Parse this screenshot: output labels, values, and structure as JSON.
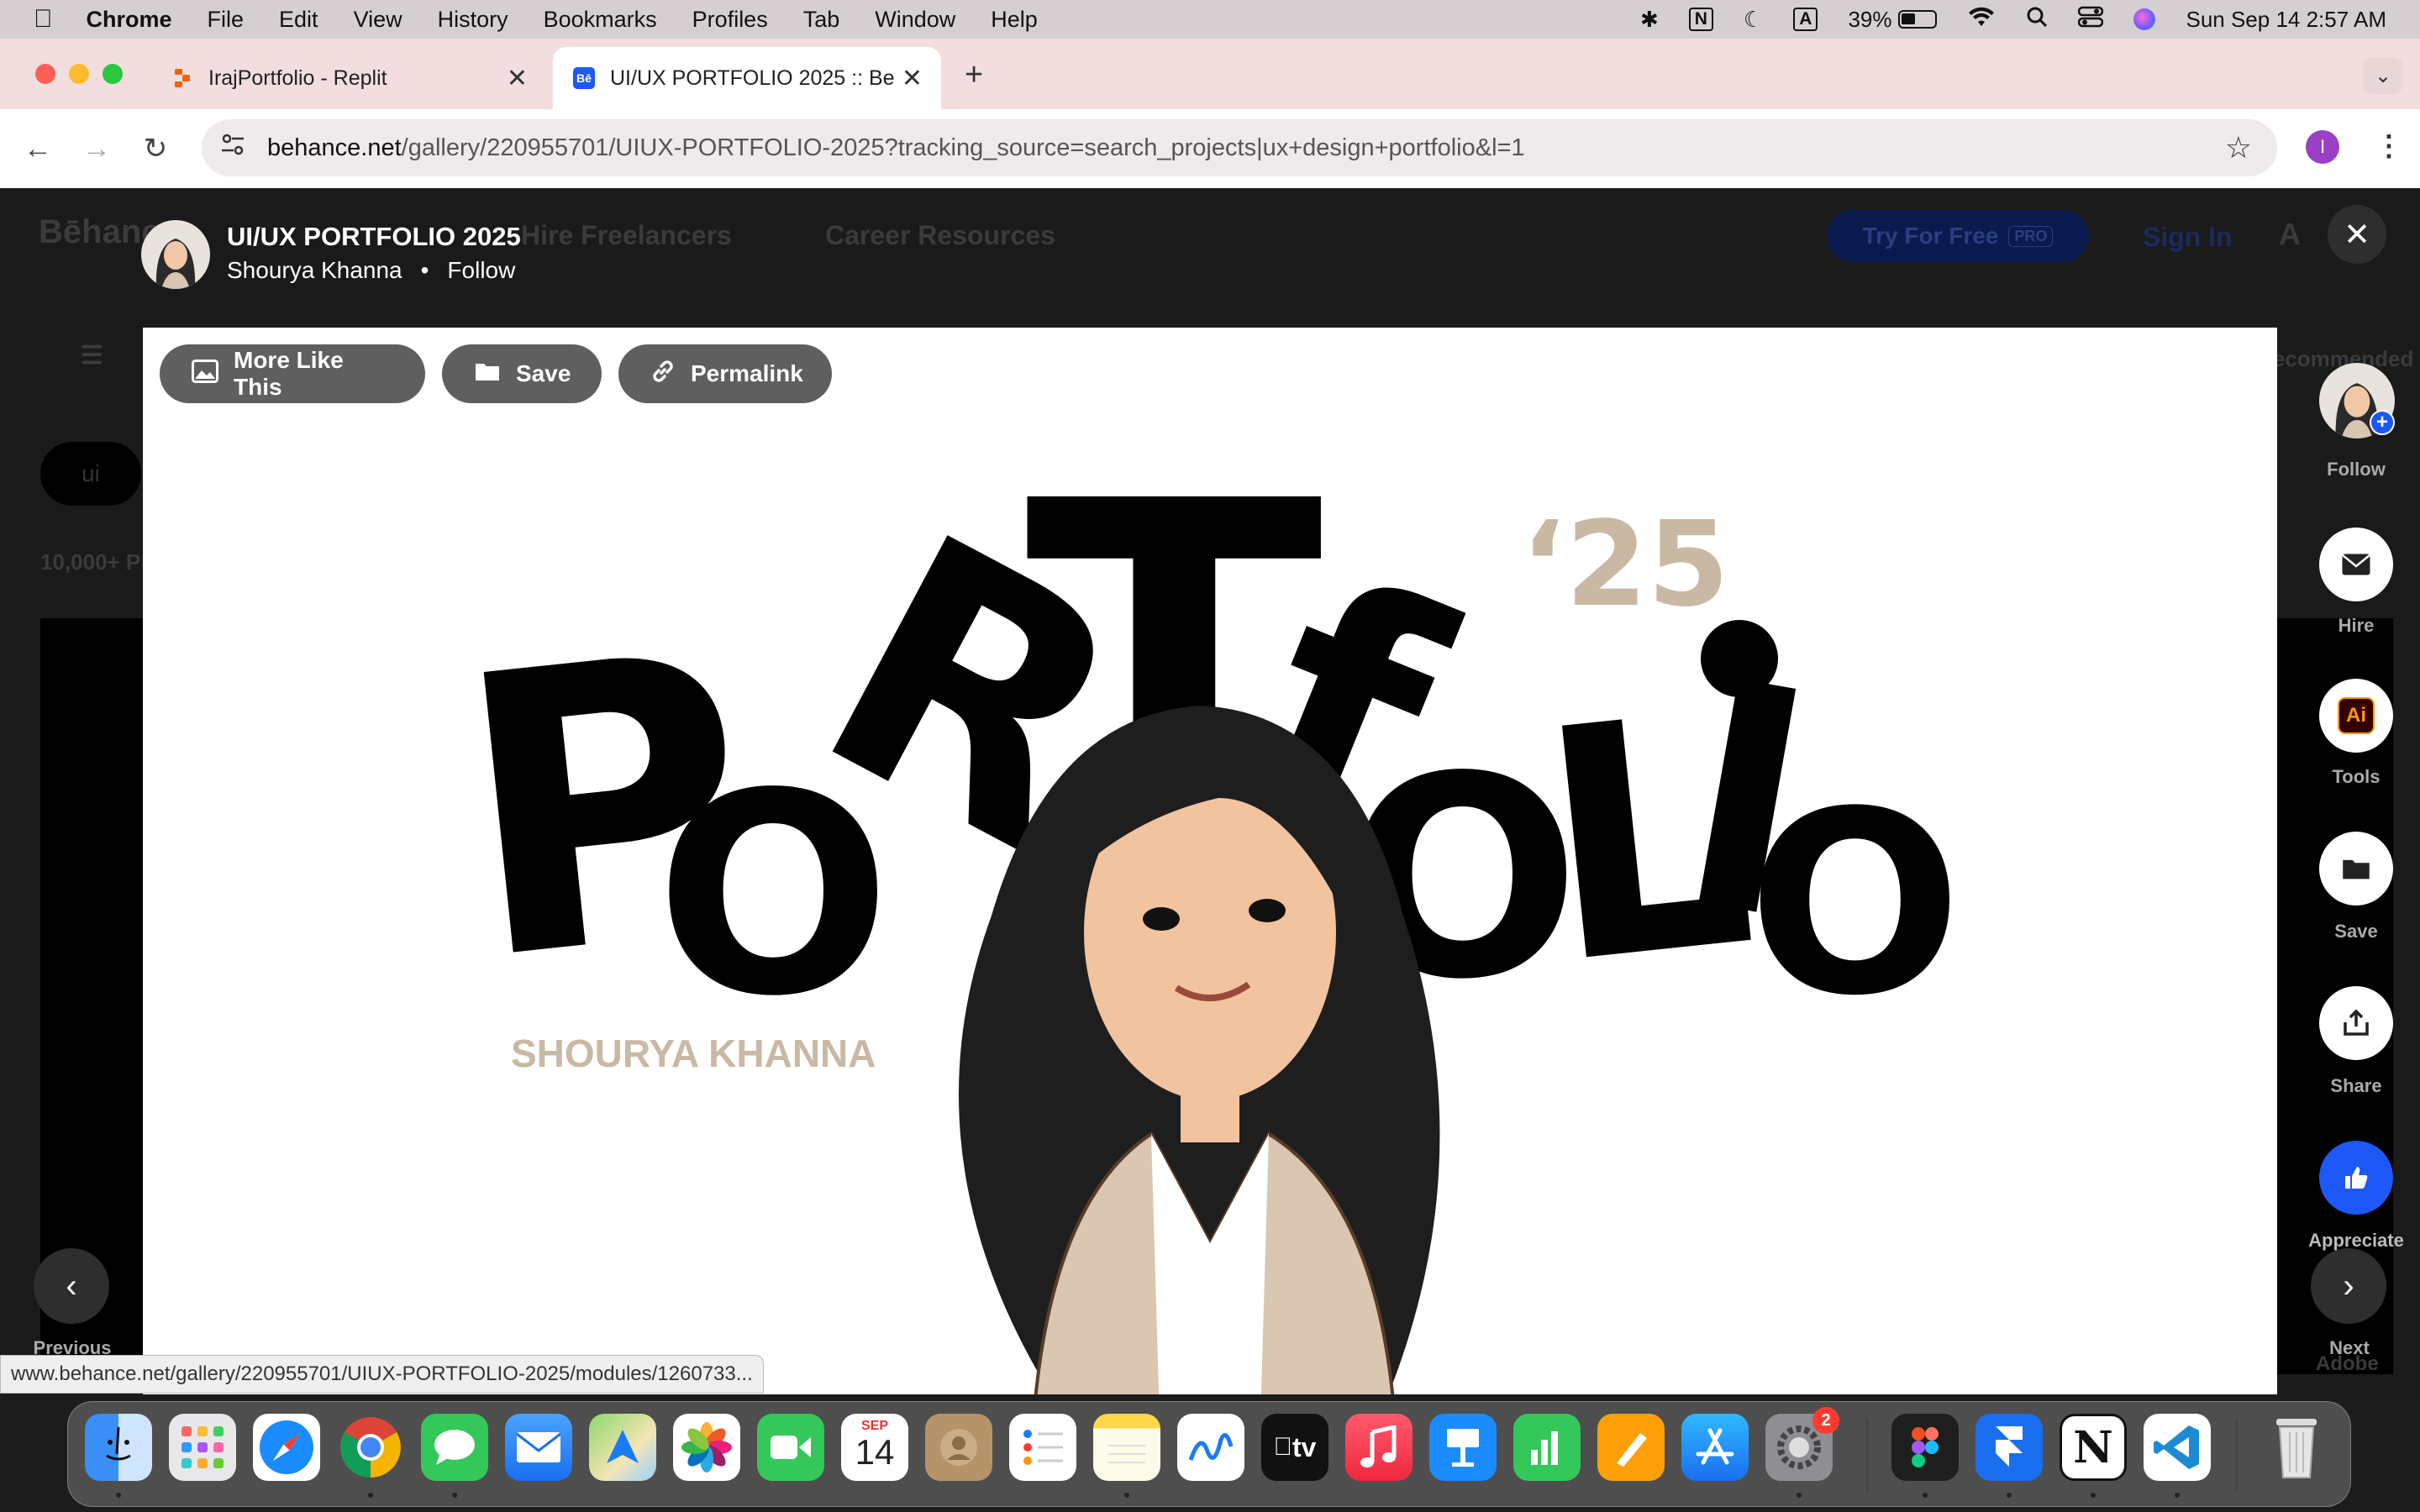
{
  "menubar": {
    "app": "Chrome",
    "items": [
      "File",
      "Edit",
      "View",
      "History",
      "Bookmarks",
      "Profiles",
      "Tab",
      "Window",
      "Help"
    ],
    "battery": "39%",
    "datetime": "Sun Sep 14  2:57 AM",
    "input_indicator": "A",
    "notion_indicator": "N"
  },
  "tabs": [
    {
      "title": "IrajPortfolio - Replit",
      "favicon": "replit-icon"
    },
    {
      "title": "UI/UX PORTFOLIO 2025 :: Be",
      "favicon": "behance-icon",
      "favicon_text": "Bē"
    }
  ],
  "toolbar": {
    "url_domain": "behance.net",
    "url_path": "/gallery/220955701/UIUX-PORTFOLIO-2025?tracking_source=search_projects|ux+design+portfolio&l=1",
    "profile_initial": "I"
  },
  "background_page": {
    "logo": "Bēhance",
    "nav1": "Hire Freelancers",
    "nav2": "Career Resources",
    "try_btn": "Try For Free",
    "pro": "PRO",
    "signin": "Sign In",
    "chip": "ui",
    "count": "10,000+ P",
    "recommended": "Recommended",
    "adobe": "Adobe"
  },
  "project": {
    "title": "UI/UX PORTFOLIO 2025",
    "author": "Shourya Khanna",
    "separator": "•",
    "follow": "Follow",
    "buttons": {
      "more": "More Like This",
      "save": "Save",
      "permalink": "Permalink"
    },
    "artwork": {
      "year": "‘25",
      "letters": [
        "P",
        "O",
        "R",
        "T",
        "f",
        "O",
        "L",
        "I",
        "O"
      ],
      "name": "SHOURYA KHANNA"
    }
  },
  "sidebar": {
    "follow": "Follow",
    "hire": "Hire",
    "tools": "Tools",
    "tools_icon_text": "Ai",
    "save": "Save",
    "share": "Share",
    "appreciate": "Appreciate"
  },
  "nav": {
    "previous": "Previous",
    "next": "Next"
  },
  "status_url": "www.behance.net/gallery/220955701/UIUX-PORTFOLIO-2025/modules/1260733...",
  "dock": {
    "calendar_month": "SEP",
    "calendar_day": "14",
    "settings_badge": "2",
    "tv_label": "tv",
    "notion_label": "N"
  },
  "colors": {
    "accent_blue": "#1d58f7",
    "artwork_beige": "#c9b9a4",
    "tab_strip": "#f3dedf"
  }
}
